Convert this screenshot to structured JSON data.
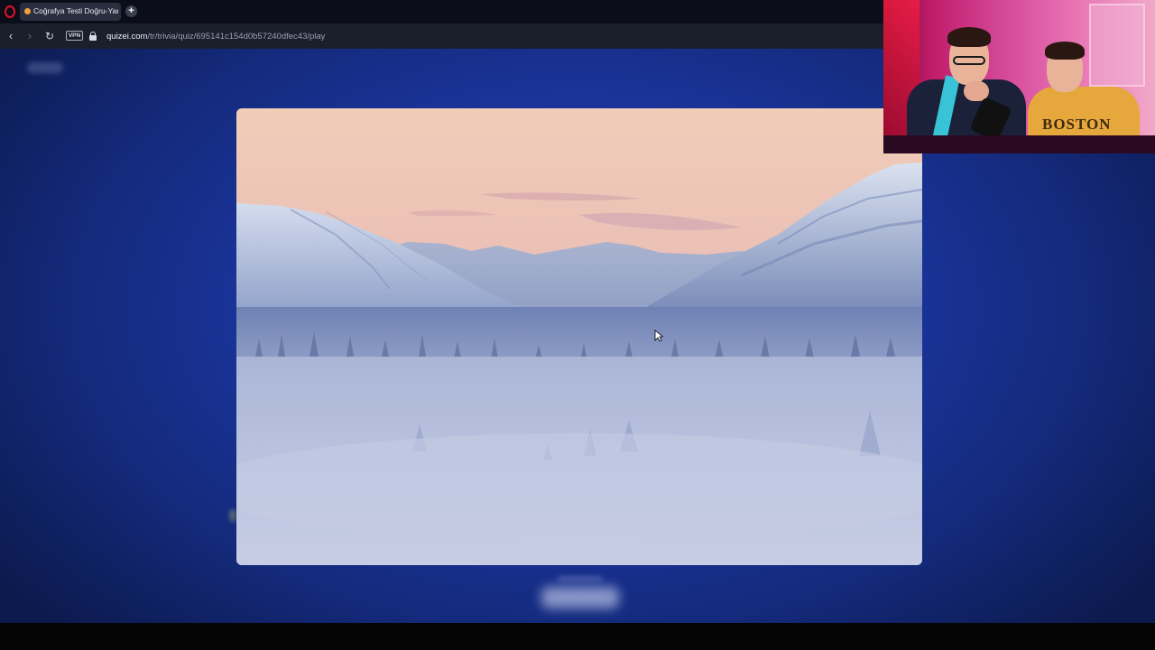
{
  "browser": {
    "tab_title": "Coğrafya Testi Doğru-Yanlış",
    "new_tab_label": "+",
    "vpn_label": "VPN",
    "url_domain": "quizei.com",
    "url_path": "/tr/trivia/quiz/695141c154d0b57240dfec43/play"
  },
  "icons": {
    "browser_logo": "opera-logo-icon",
    "back": "back-arrow-icon",
    "forward": "forward-arrow-icon",
    "reload": "reload-icon",
    "lock": "lock-icon",
    "cursor": "mouse-pointer-icon"
  },
  "colors": {
    "page_background": "#1c38a6",
    "browser_chrome": "#1b1f2c",
    "opera_red": "#e0102a"
  },
  "webcam": {
    "shirt_text": "BOSTON"
  }
}
